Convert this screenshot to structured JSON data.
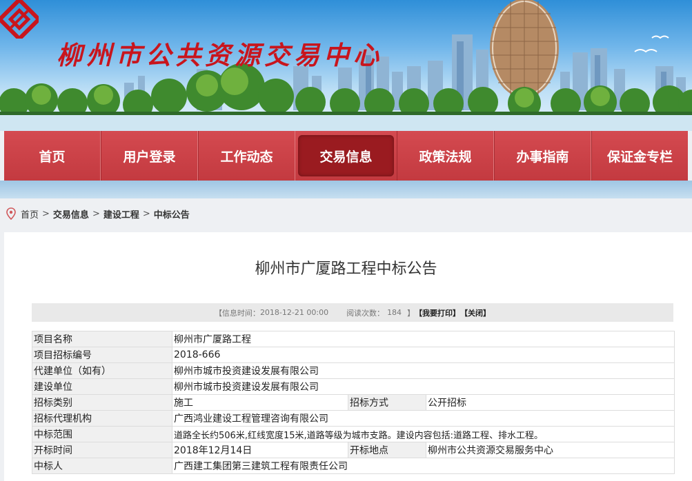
{
  "header": {
    "site_title": "柳州市公共资源交易中心",
    "logo_icon": "diamond-interlock-logo",
    "brand_color": "#c8151d"
  },
  "nav": {
    "items": [
      "首页",
      "用户登录",
      "工作动态",
      "交易信息",
      "政策法规",
      "办事指南",
      "保证金专栏"
    ],
    "active": "交易信息",
    "bar_color": "#c94146"
  },
  "breadcrumb": {
    "icon": "location-pin-icon",
    "items": [
      "首页",
      "交易信息",
      "建设工程",
      "中标公告"
    ],
    "separator": ">"
  },
  "article": {
    "title": "柳州市广厦路工程中标公告",
    "info_time_label": "【信息时间：",
    "info_time": "2018-12-21 00:00",
    "view_count_label": "阅读次数：",
    "view_count": "184",
    "print_label": "【我要打印】",
    "close_label": "【关闭】",
    "bracket_close": "】"
  },
  "details": {
    "project_name_label": "项目名称",
    "project_name": "柳州市广厦路工程",
    "bid_no_label": "项目招标编号",
    "bid_no": "2018-666",
    "agent_builder_label": "代建单位（如有）",
    "agent_builder": "柳州市城市投资建设发展有限公司",
    "builder_label": "建设单位",
    "builder": "柳州市城市投资建设发展有限公司",
    "bid_type_label": "招标类别",
    "bid_type": "施工",
    "bid_method_label": "招标方式",
    "bid_method": "公开招标",
    "agency_label": "招标代理机构",
    "agency": "广西鸿业建设工程管理咨询有限公司",
    "scope_label": "中标范围",
    "scope": "道路全长约506米,红线宽度15米,道路等级为城市支路。建设内容包括:道路工程、排水工程。",
    "open_time_label": "开标时间",
    "open_time": "2018年12月14日",
    "open_place_label": "开标地点",
    "open_place": "柳州市公共资源交易服务中心",
    "winner_label": "中标人",
    "winner": "广西建工集团第三建筑工程有限责任公司"
  }
}
